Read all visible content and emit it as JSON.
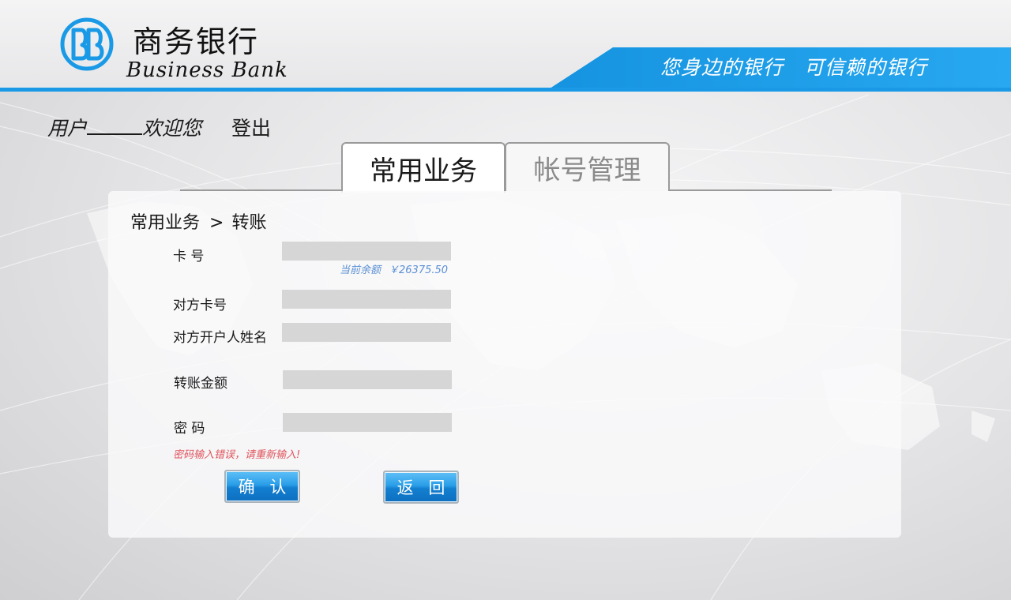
{
  "header": {
    "bank_name_cn": "商务银行",
    "bank_name_en": "Business Bank",
    "slogan": "您身边的银行　可信赖的银行",
    "brand_color": "#1a9ae6",
    "logo_icon": "bb-logo-icon"
  },
  "user_bar": {
    "prefix": "用户",
    "suffix": "欢迎您",
    "logout_label": "登出"
  },
  "tabs": [
    {
      "label": "常用业务",
      "active": true
    },
    {
      "label": "帐号管理",
      "active": false
    }
  ],
  "breadcrumb": {
    "section": "常用业务",
    "separator": ">",
    "page": "转账"
  },
  "form": {
    "card_no": {
      "label": "卡 号",
      "value": ""
    },
    "balance": {
      "label": "当前余额",
      "amount": "￥26375.50"
    },
    "target_card_no": {
      "label": "对方卡号",
      "value": ""
    },
    "target_name": {
      "label": "对方开户人姓名",
      "value": ""
    },
    "amount": {
      "label": "转账金额",
      "value": ""
    },
    "password": {
      "label": "密 码",
      "value": ""
    },
    "error": "密码输入错误，请重新输入!"
  },
  "buttons": {
    "confirm_label": "确 认",
    "back_label": "返 回"
  }
}
